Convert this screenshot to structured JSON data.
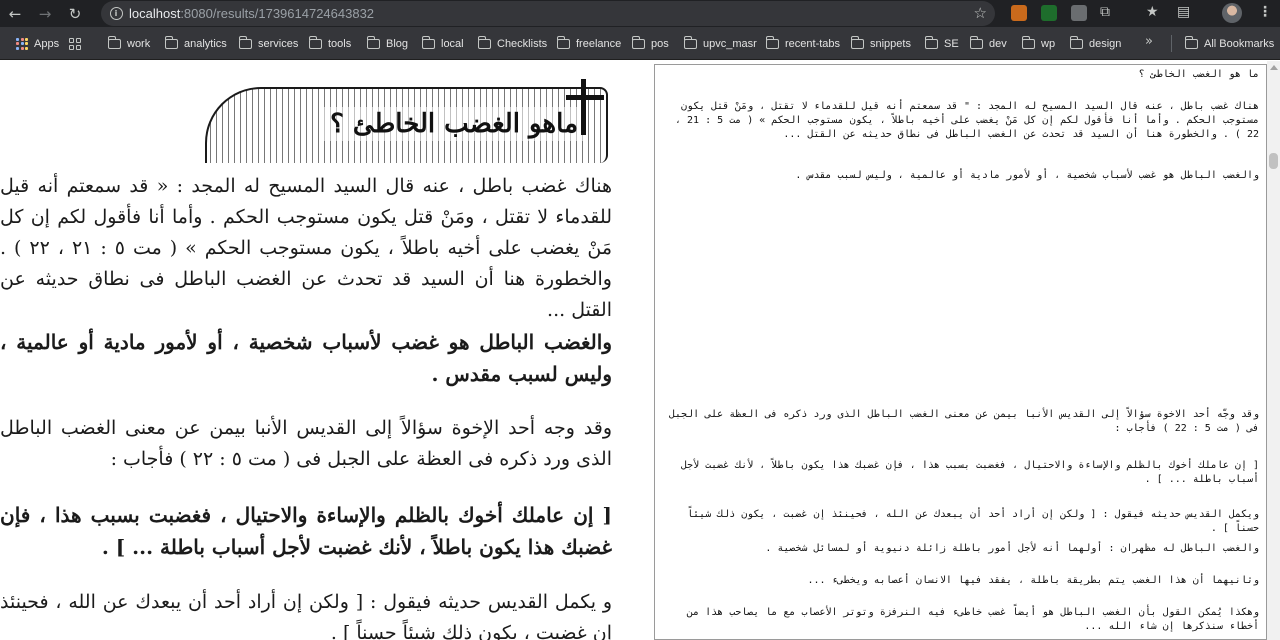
{
  "browser": {
    "nav": {
      "back_icon": "←",
      "forward_icon": "→",
      "reload_icon": "↻"
    },
    "omnibox": {
      "host": "localhost",
      "path": ":8080/results/1739614724643832",
      "star_icon": "☆"
    },
    "toolbar": {
      "puzzle_icon": "⧉",
      "star_icon": "★",
      "reading_icon": "▤",
      "menu_icon": "⋮"
    }
  },
  "bookmarks": {
    "apps_label": "Apps",
    "folders": [
      "work",
      "analytics",
      "services",
      "tools",
      "Blog",
      "local",
      "Checklists",
      "freelance",
      "pos",
      "upvc_masr",
      "recent-tabs",
      "snippets",
      "SE",
      "dev",
      "wp",
      "design"
    ],
    "more_icon": "»",
    "all_bookmarks_label": "All Bookmarks"
  },
  "scan": {
    "header_title": "ماهو الغضب الخاطئ ؟",
    "p1": "هناك غضب باطل ، عنه قال السيد المسيح له المجد : « قد سمعتم أنه قيل للقدماء لا تقتل ، ومَنْ قتل يكون مستوجب الحكم . وأما أنا فأقول لكم إن كل مَنْ يغضب على أخيه باطلاً ، يكون مستوجب الحكم » ( مت ٥ : ٢١ ، ٢٢ ) . والخطورة هنا أن السيد قد تحدث عن الغضب الباطل فى نطاق حديثه عن القتل ...",
    "p2": "والغضب الباطل هو غضب لأسباب شخصية ، أو لأمور مادية أو عالمية ، وليس لسبب مقدس .",
    "p3": "وقد وجه أحد الإخوة سؤالاً إلى القديس الأنبا بيمن عن معنى الغضب الباطل الذى ورد ذكره فى العظة على الجبل فى ( مت ٥ : ٢٢ ) فأجاب :",
    "p4": "[ إن عاملك أخوك بالظلم والإساءة والاحتيال ، فغضبت بسبب هذا ، فإن غضبك هذا يكون باطلاً ، لأنك غضبت لأجل أسباب باطلة ... ] .",
    "p5": "و يكمل القديس حديثه فيقول : [ ولكن إن أراد أحد أن يبعدك عن الله ، فحينئذ إن غضبت ، يكون ذلك شيئاً حسناً ] ."
  },
  "ocr": {
    "l1": "ما هو الغضب الخاطئ ؟",
    "l2": "هناك غضب باطل ، عنه قال السيد المسيح له المجد : \" قد سمعتم أنه قيل للقدماء لا تقتل ، ومَنْ قتل يكون مستوجب الحكم . وأما أنا فأقول لكم إن كل مَنْ يغضب على أخيه باطلاً ، يكون مستوجب الحكم » ( مت 5 : 21 ، 22 ) . والخطورة هنا أن السيد قد تحدث عن الغضب الباطل فى نطاق حديثه عن القتل ...",
    "l3": "والغضب الباطل هو غضب لأسباب شخصية ، أو لأمور مادية أو عالمية ، وليس لسبب مقدس .",
    "l4": "وقد وجّه أحد الاخوة سؤالاً إلى القديس الأنبا بيمن عن معنى الغضب الباطل الذى ورد ذكره فى العظة على الجبل فى ( مت 5 : 22 ) فأجاب :",
    "l5": "[ إن عاملك أخوك بالظلم والإساءة والاحتيال ، فغضبت بسبب هذا ، فإن غضبك هذا يكون باطلاً ، لأنك غضبت لأجل أسباب باطلة ... ] .",
    "l6": "ويكمل القديس حديثه فيقول : [ ولكن إن أراد أحد أن يبعدك عن الله ، فحينئذ إن غضبت ، يكون ذلك شيئاً حسناً ] .",
    "l7": "والغضب الباطل له مظهران : أولهما أنه لأجل أمور باطلة زائلة دنيوية أو لمسائل شخصية .",
    "l8": "وثانيهما أن هذا الغضب يتم بطريقة باطلة ، يفقد فيها الانسان أعصابه ويخطىء ...",
    "l9": "وهكذا يُمكن القول بأن الغضب الباطل هو أيضاً غضب خاطىء فيه النرفزة وتوتر الأعصاب مع ما يصاحب هذا من أخطاء سنذكرها إن شاء الله ..."
  }
}
